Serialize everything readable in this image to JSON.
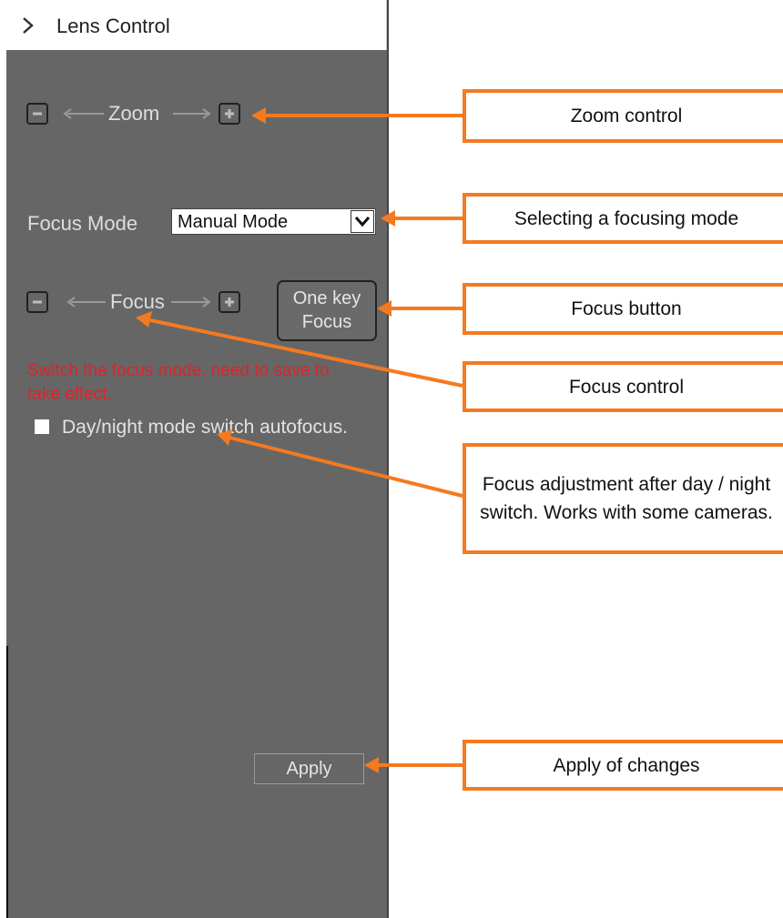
{
  "header": {
    "title": "Lens Control",
    "icon": "chevron-right-icon"
  },
  "zoom": {
    "label": "Zoom",
    "minus_icon": "minus-icon",
    "plus_icon": "plus-icon"
  },
  "focus_mode": {
    "label": "Focus Mode",
    "selected": "Manual Mode",
    "dropdown_icon": "chevron-down-icon"
  },
  "focus": {
    "label": "Focus",
    "minus_icon": "minus-icon",
    "plus_icon": "plus-icon"
  },
  "one_key_focus": {
    "line1": "One key",
    "line2": "Focus"
  },
  "warning": "Switch the focus mode, need to save to take effect.",
  "day_night": {
    "label": "Day/night mode switch autofocus.",
    "checked": false
  },
  "apply_label": "Apply",
  "callouts": {
    "zoom": "Zoom control",
    "focus_mode": "Selecting a focusing mode",
    "focus_button": "Focus button",
    "focus_control": "Focus control",
    "day_night": "Focus adjustment after day / night switch. Works with some cameras.",
    "apply": "Apply of changes"
  },
  "colors": {
    "panel": "#666666",
    "accent_orange": "#f47a20",
    "warning_red": "#e0222a"
  }
}
